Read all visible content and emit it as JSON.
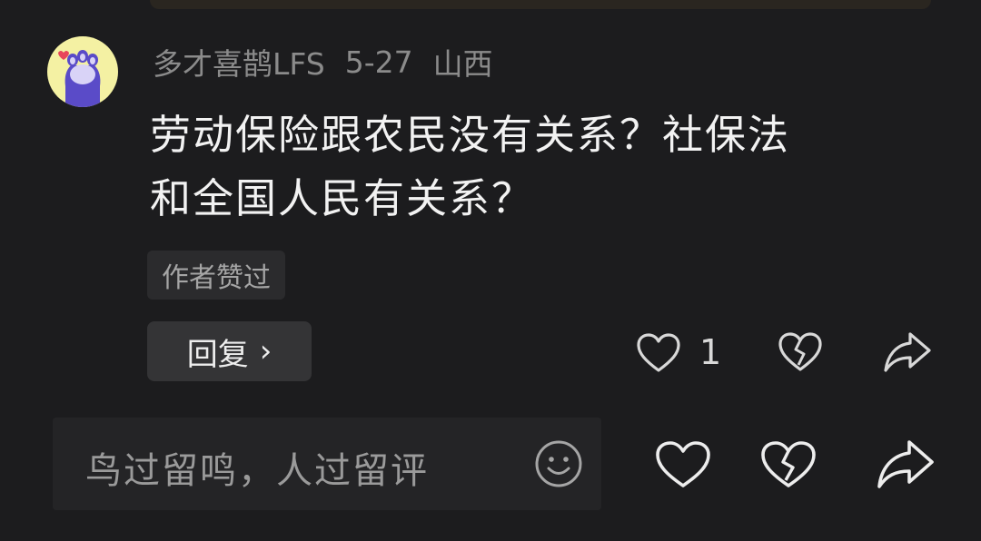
{
  "comment": {
    "username": "多才喜鹊LFS",
    "date": "5-27",
    "location": "山西",
    "text_line1": "劳动保险跟农民没有关系？社保法",
    "text_line2": "和全国人民有关系？",
    "author_badge": "作者赞过",
    "reply_label": "回复",
    "reply_chevron": "›",
    "like_count": "1",
    "icons": [
      "heart-icon",
      "broken-heart-icon",
      "share-icon"
    ]
  },
  "bottom_bar": {
    "placeholder": "鸟过留鸣，人过留评",
    "icons": [
      "emoji-icon",
      "heart-icon",
      "broken-heart-icon",
      "share-icon"
    ]
  },
  "colors": {
    "background": "#1c1c1e",
    "text": "#f2f2f2",
    "muted": "#8b8b8b",
    "avatar_bg": "#f4f1a3",
    "paw": "#5a4bc8"
  }
}
